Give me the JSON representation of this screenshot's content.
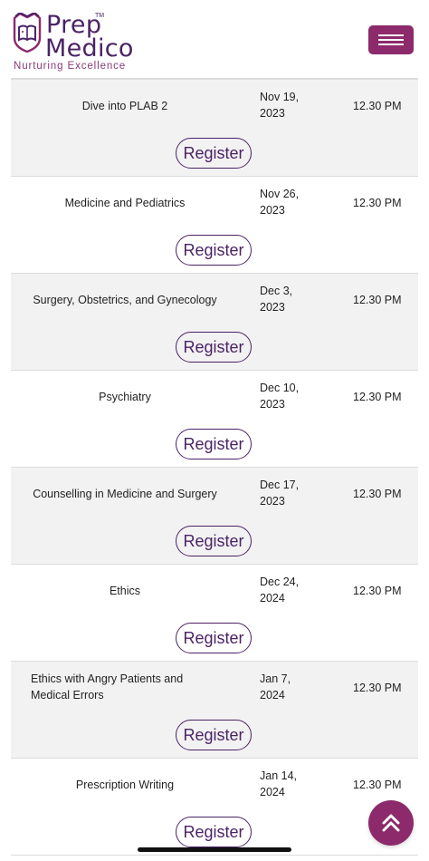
{
  "brand": {
    "name_line1": "Prep",
    "name_line2": "Medico",
    "trademark": "TM",
    "tagline": "Nurturing Excellence",
    "primary_color": "#4b2366",
    "accent_color": "#8c2a6b",
    "logo_icon": "book-shield-icon"
  },
  "header": {
    "menu_icon": "hamburger-icon"
  },
  "schedule": {
    "register_label": "Register",
    "rows": [
      {
        "topic": "Dive into PLAB 2",
        "date_line1": "Nov 19,",
        "date_line2": "2023",
        "time": "12.30 PM"
      },
      {
        "topic": "Medicine and Pediatrics",
        "date_line1": "Nov 26,",
        "date_line2": "2023",
        "time": "12.30 PM"
      },
      {
        "topic": "Surgery, Obstetrics, and Gynecology",
        "date_line1": "Dec 3,",
        "date_line2": "2023",
        "time": "12.30 PM"
      },
      {
        "topic": "Psychiatry",
        "date_line1": "Dec 10,",
        "date_line2": "2023",
        "time": "12.30 PM"
      },
      {
        "topic": "Counselling in Medicine and Surgery",
        "date_line1": "Dec 17,",
        "date_line2": "2023",
        "time": "12.30 PM"
      },
      {
        "topic": "Ethics",
        "date_line1": "Dec 24,",
        "date_line2": "2024",
        "time": "12.30 PM"
      },
      {
        "topic_line1": "Ethics with Angry Patients and",
        "topic_line2": "Medical Errors",
        "date_line1": "Jan 7,",
        "date_line2": "2024",
        "time": "12.30 PM"
      },
      {
        "topic": "Prescription Writing",
        "date_line1": "Jan 14,",
        "date_line2": "2024",
        "time": "12.30 PM"
      }
    ]
  },
  "scroll_top": {
    "icon": "double-chevron-up-icon"
  }
}
